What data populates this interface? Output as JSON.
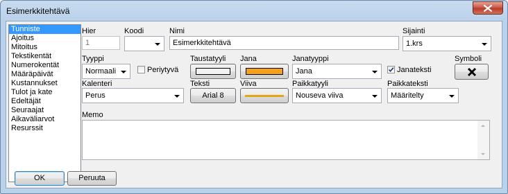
{
  "window": {
    "title": "Esimerkkitehtävä"
  },
  "sidebar": {
    "items": [
      {
        "label": "Tunniste",
        "selected": true
      },
      {
        "label": "Ajoitus"
      },
      {
        "label": "Mitoitus"
      },
      {
        "label": "Tekstikentät"
      },
      {
        "label": "Numerokentät"
      },
      {
        "label": "Määräpäivät"
      },
      {
        "label": "Kustannukset"
      },
      {
        "label": "Tulot ja kate"
      },
      {
        "label": "Edeltäjät"
      },
      {
        "label": "Seuraajat"
      },
      {
        "label": "Aikaväliarvot"
      },
      {
        "label": "Resurssit"
      }
    ]
  },
  "form": {
    "hier": {
      "label": "Hier",
      "value": "1"
    },
    "koodi": {
      "label": "Koodi",
      "value": ""
    },
    "nimi": {
      "label": "Nimi",
      "value": "Esimerkkitehtävä"
    },
    "sijainti": {
      "label": "Sijainti",
      "value": "1.krs"
    },
    "tyyppi": {
      "label": "Tyyppi",
      "value": "Normaali"
    },
    "periytyva": {
      "label": "Periytyvä",
      "checked": false
    },
    "taustatyyli": {
      "label": "Taustatyyli",
      "color": "#f2f2f2"
    },
    "jana": {
      "label": "Jana",
      "color": "#f5a01a"
    },
    "janatyyppi": {
      "label": "Janatyyppi",
      "value": "Jana"
    },
    "janateksti": {
      "label": "Janateksti",
      "checked": true
    },
    "symboli": {
      "label": "Symboli",
      "icon": "x-icon"
    },
    "kalenteri": {
      "label": "Kalenteri",
      "value": "Perus"
    },
    "teksti": {
      "label": "Teksti",
      "value": "Arial 8"
    },
    "viiva": {
      "label": "Viiva",
      "color": "#e8a317"
    },
    "paikkatyyli": {
      "label": "Paikkatyyli",
      "value": "Nouseva viiva"
    },
    "paikkateksti": {
      "label": "Paikkateksti",
      "value": "Määritelty"
    },
    "memo": {
      "label": "Memo",
      "value": ""
    }
  },
  "buttons": {
    "ok": "OK",
    "cancel": "Peruuta"
  },
  "colors": {
    "selection": "#3399ff",
    "close_button": "#c8523f",
    "frame": "#b9d1ea"
  }
}
